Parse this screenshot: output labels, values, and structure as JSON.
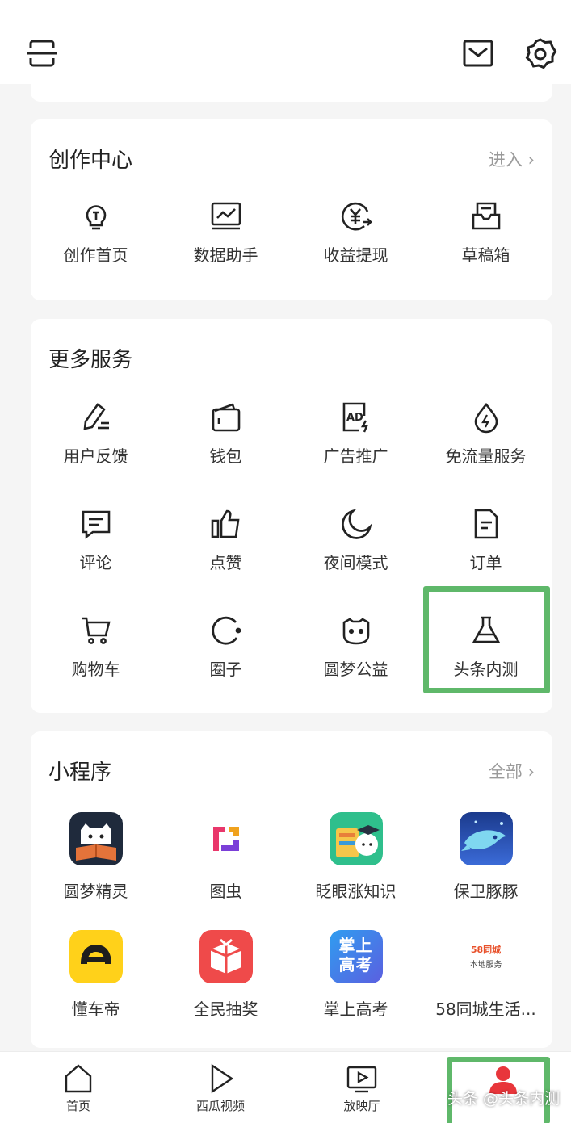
{
  "creation_center": {
    "title": "创作中心",
    "more": "进入 ›",
    "items": [
      {
        "label": "创作首页",
        "icon": "lightbulb-icon"
      },
      {
        "label": "数据助手",
        "icon": "chart-monitor-icon"
      },
      {
        "label": "收益提现",
        "icon": "yuan-withdraw-icon"
      },
      {
        "label": "草稿箱",
        "icon": "draft-box-icon"
      }
    ]
  },
  "more_services": {
    "title": "更多服务",
    "items": [
      {
        "label": "用户反馈",
        "icon": "feedback-pen-icon"
      },
      {
        "label": "钱包",
        "icon": "wallet-icon"
      },
      {
        "label": "广告推广",
        "icon": "ad-icon"
      },
      {
        "label": "免流量服务",
        "icon": "data-drop-icon"
      },
      {
        "label": "评论",
        "icon": "comment-icon"
      },
      {
        "label": "点赞",
        "icon": "thumbs-up-icon"
      },
      {
        "label": "夜间模式",
        "icon": "moon-icon"
      },
      {
        "label": "订单",
        "icon": "order-doc-icon"
      },
      {
        "label": "购物车",
        "icon": "cart-icon"
      },
      {
        "label": "圈子",
        "icon": "circle-icon"
      },
      {
        "label": "圆梦公益",
        "icon": "cat-face-icon"
      },
      {
        "label": "头条内测",
        "icon": "flask-icon"
      }
    ]
  },
  "mini_programs": {
    "title": "小程序",
    "more": "全部 ›",
    "items": [
      {
        "label": "圆梦精灵",
        "icon": "cat-book-app-icon"
      },
      {
        "label": "图虫",
        "icon": "tuchong-app-icon"
      },
      {
        "label": "眨眼涨知识",
        "icon": "knowledge-app-icon"
      },
      {
        "label": "保卫豚豚",
        "icon": "whale-app-icon"
      },
      {
        "label": "懂车帝",
        "icon": "dongchedi-app-icon"
      },
      {
        "label": "全民抽奖",
        "icon": "lottery-app-icon"
      },
      {
        "label": "掌上高考",
        "icon": "gaokao-app-icon",
        "icon_text": "掌上高考"
      },
      {
        "label": "58同城生活...",
        "icon": "58-app-icon",
        "icon_text_1": "58同城",
        "icon_text_2": "本地服务"
      }
    ]
  },
  "tabbar": {
    "items": [
      {
        "label": "首页",
        "icon": "home-icon"
      },
      {
        "label": "西瓜视频",
        "icon": "play-icon"
      },
      {
        "label": "放映厅",
        "icon": "tv-play-icon"
      },
      {
        "label": "",
        "icon": "profile-icon"
      }
    ],
    "watermark": "头条 @头条内测"
  },
  "colors": {
    "highlight": "#5fb86a",
    "profile_active": "#e8363b"
  }
}
